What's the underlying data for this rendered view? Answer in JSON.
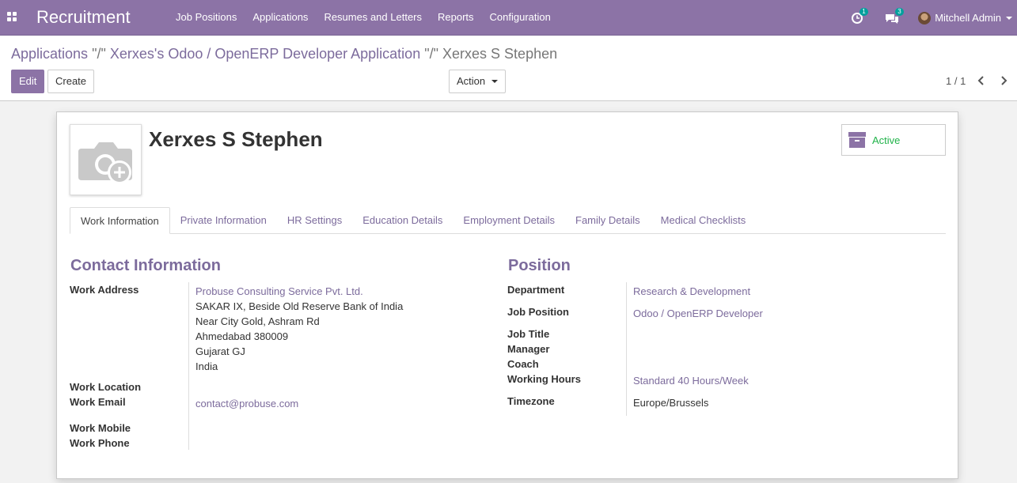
{
  "navbar": {
    "app_title": "Recruitment",
    "menu": [
      "Job Positions",
      "Applications",
      "Resumes and Letters",
      "Reports",
      "Configuration"
    ],
    "activity_count": "1",
    "message_count": "3",
    "user_name": "Mitchell Admin"
  },
  "breadcrumb": {
    "items": [
      "Applications",
      "\"/\"",
      "Xerxes's Odoo / OpenERP Developer Application",
      "\"/\""
    ],
    "current": "Xerxes S Stephen"
  },
  "buttons": {
    "edit": "Edit",
    "create": "Create",
    "action": "Action"
  },
  "pager": {
    "value": "1 / 1"
  },
  "employee": {
    "name": "Xerxes S Stephen",
    "status": "Active"
  },
  "tabs": [
    "Work Information",
    "Private Information",
    "HR Settings",
    "Education Details",
    "Employment Details",
    "Family Details",
    "Medical Checklists"
  ],
  "contact": {
    "title": "Contact Information",
    "work_address_label": "Work Address",
    "company": "Probuse Consulting Service Pvt. Ltd.",
    "address_lines": [
      "SAKAR IX, Beside Old Reserve Bank of India",
      "Near City Gold, Ashram Rd",
      "Ahmedabad 380009",
      "Gujarat GJ",
      "India"
    ],
    "work_location_label": "Work Location",
    "work_email_label": "Work Email",
    "work_email": "contact@probuse.com",
    "work_mobile_label": "Work Mobile",
    "work_phone_label": "Work Phone"
  },
  "position": {
    "title": "Position",
    "department_label": "Department",
    "department": "Research & Development",
    "job_position_label": "Job Position",
    "job_position": "Odoo / OpenERP Developer",
    "job_title_label": "Job Title",
    "manager_label": "Manager",
    "coach_label": "Coach",
    "working_hours_label": "Working Hours",
    "working_hours": "Standard 40 Hours/Week",
    "timezone_label": "Timezone",
    "timezone": "Europe/Brussels"
  },
  "colors": {
    "brand": "#8c73a6",
    "link": "#7c6b9c",
    "active": "#21b34a"
  }
}
